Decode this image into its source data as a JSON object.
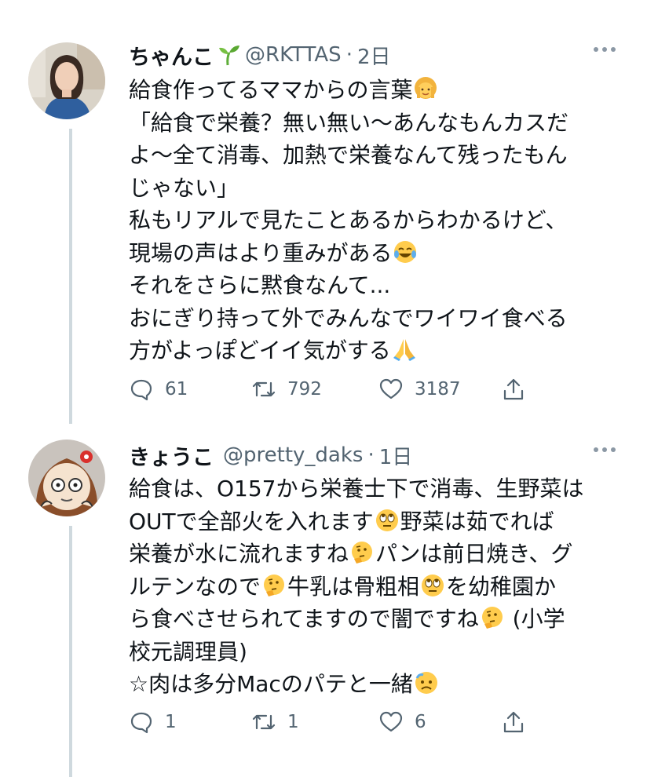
{
  "colors": {
    "text": "#0f1419",
    "secondary": "#536471",
    "thread_line": "#cfd9de"
  },
  "tweets": [
    {
      "name": "ちゃんこ",
      "name_icon": "seedling-icon",
      "handle": "@RKTTAS",
      "dot": "·",
      "time": "2日",
      "lines": [
        "給食作ってるママからの言葉",
        "「給食で栄養？無い無い〜あんなもんカスだ",
        "よ〜全て消毒、加熱で栄養なんて残ったもん",
        "じゃない」",
        "私もリアルで見たことあるからわかるけど、",
        "現場の声はより重みがある",
        "それをさらに黙食なんて...",
        "おにぎり持って外でみんなでワイワイ食べる",
        "方がよっぽどイイ気がする"
      ],
      "emojis": [
        "woman-emoji",
        "tears-of-joy-emoji",
        "folded-hands-emoji"
      ],
      "counts": {
        "reply": "61",
        "retweet": "792",
        "like": "3187"
      }
    },
    {
      "name": "きょうこ",
      "handle": "@pretty_daks",
      "dot": "·",
      "time": "1日",
      "segments": {
        "l1": "給食は、O157から栄養士下で消毒、生野菜は",
        "l2a": "OUTで全部火を入れます",
        "l2b": "野菜は茹でれば",
        "l3a": "栄養が水に流れますね",
        "l3b": "パンは前日焼き、グ",
        "l4a": "ルテンなので",
        "l4b": "牛乳は骨粗相",
        "l4c": "を幼稚園か",
        "l5a": "ら食べさせられてますので闇ですね",
        "l5b": "(小学",
        "l6": "校元調理員)",
        "l7a": "☆肉は多分Macのパテと一緒"
      },
      "emojis": [
        "eye-roll-emoji",
        "thinking-emoji",
        "sad-sweat-emoji"
      ],
      "counts": {
        "reply": "1",
        "retweet": "1",
        "like": "6"
      }
    }
  ],
  "icons": [
    "reply-icon",
    "retweet-icon",
    "like-icon",
    "share-icon",
    "more-icon"
  ]
}
